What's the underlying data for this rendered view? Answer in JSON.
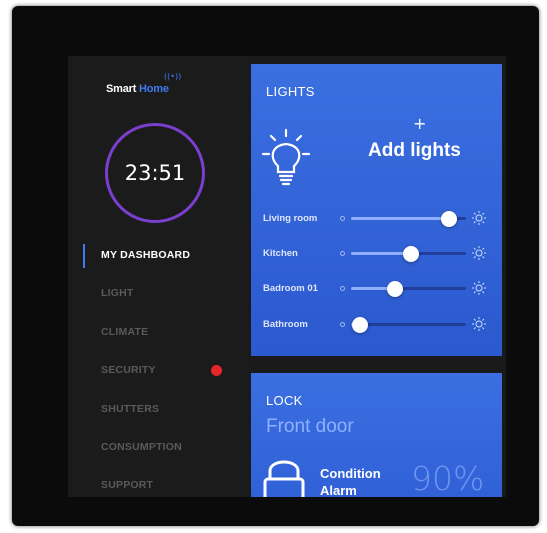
{
  "brand": {
    "part1": "Smart",
    "part2": "Home",
    "icon": "signal-icon"
  },
  "clock": {
    "time": "23:51",
    "ring_color": "#7b3fd0"
  },
  "nav": {
    "items": [
      {
        "label": "MY DASHBOARD",
        "active": true
      },
      {
        "label": "LIGHT"
      },
      {
        "label": "CLIMATE"
      },
      {
        "label": "SECURITY",
        "alert": true
      },
      {
        "label": "SHUTTERS"
      },
      {
        "label": "CONSUMPTION"
      },
      {
        "label": "SUPPORT"
      }
    ]
  },
  "lights": {
    "title": "LIGHTS",
    "add_plus": "+",
    "add_label": "Add lights",
    "bulb_icon": "lightbulb-icon",
    "rows": [
      {
        "label": "Living room",
        "level": 0.85
      },
      {
        "label": "Kitchen",
        "level": 0.52
      },
      {
        "label": "Badroom 01",
        "level": 0.38
      },
      {
        "label": "Bathroom",
        "level": 0.08
      }
    ]
  },
  "lock": {
    "title": "LOCK",
    "subtitle": "Front door",
    "condition_line1": "Condition",
    "condition_line2": "Alarm",
    "percent": "90%",
    "lock_icon": "padlock-icon"
  },
  "colors": {
    "accent": "#3f7bf0",
    "panel": "#3b6fe0",
    "alert": "#e8252b",
    "sidebar": "#1b1b1b"
  }
}
